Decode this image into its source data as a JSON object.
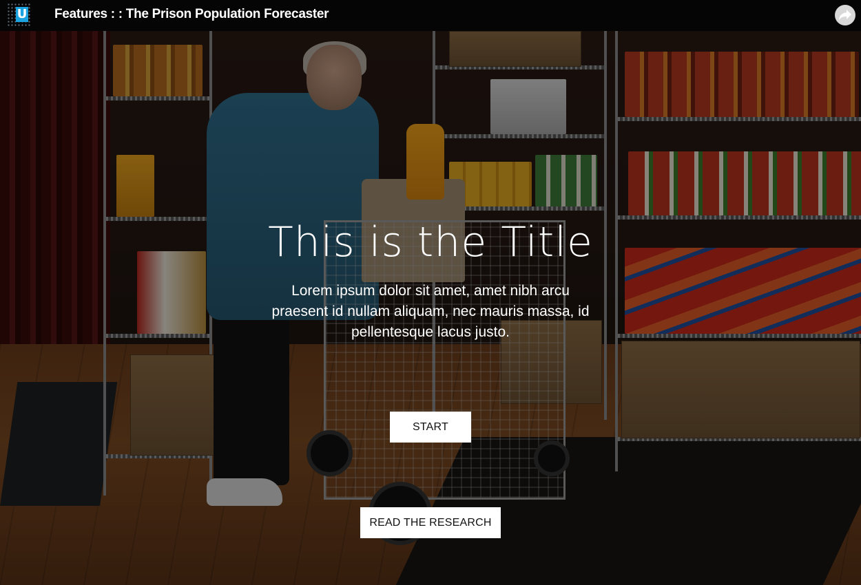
{
  "header": {
    "logo_letter": "U",
    "title": "Features : : The Prison Population Forecaster",
    "share_icon": "share-arrow-icon"
  },
  "hero": {
    "title": "This is  the Title",
    "subtitle": "Lorem ipsum dolor sit amet, amet nibh arcu praesent id nullam aliquam, nec mauris massa, id pellentesque lacus justo.",
    "start_label": "START",
    "research_label": "READ THE RESEARCH",
    "background_image": "woman-filling-shopping-cart-in-food-pantry"
  },
  "colors": {
    "topbar_bg": "#050505",
    "logo_accent": "#1aa3e0",
    "button_bg": "#ffffff",
    "text_light": "#ffffff"
  }
}
